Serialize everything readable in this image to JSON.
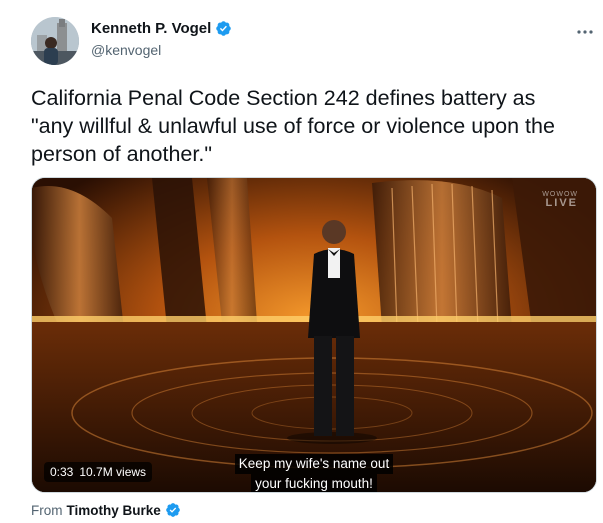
{
  "author": {
    "display_name": "Kenneth P. Vogel",
    "handle": "@kenvogel",
    "verified": true
  },
  "tweet": {
    "text_lines": [
      "California Penal Code Section 242 defines battery as",
      "\"any willful & unlawful use of force or violence upon the",
      "person of another.\""
    ]
  },
  "video": {
    "duration": "0:33",
    "views": "10.7M views",
    "caption_lines": [
      "Keep my wife's name out",
      "your fucking mouth!"
    ],
    "watermark_top": "WOWOW",
    "watermark_live": "LIVE"
  },
  "attribution": {
    "prefix": "From",
    "source_name": "Timothy Burke",
    "verified": true
  },
  "icons": {
    "more": "more-options-icon",
    "verified": "verified-badge-icon"
  },
  "colors": {
    "accent": "#1d9bf0",
    "secondary_text": "#536471",
    "primary_text": "#0f1419"
  }
}
